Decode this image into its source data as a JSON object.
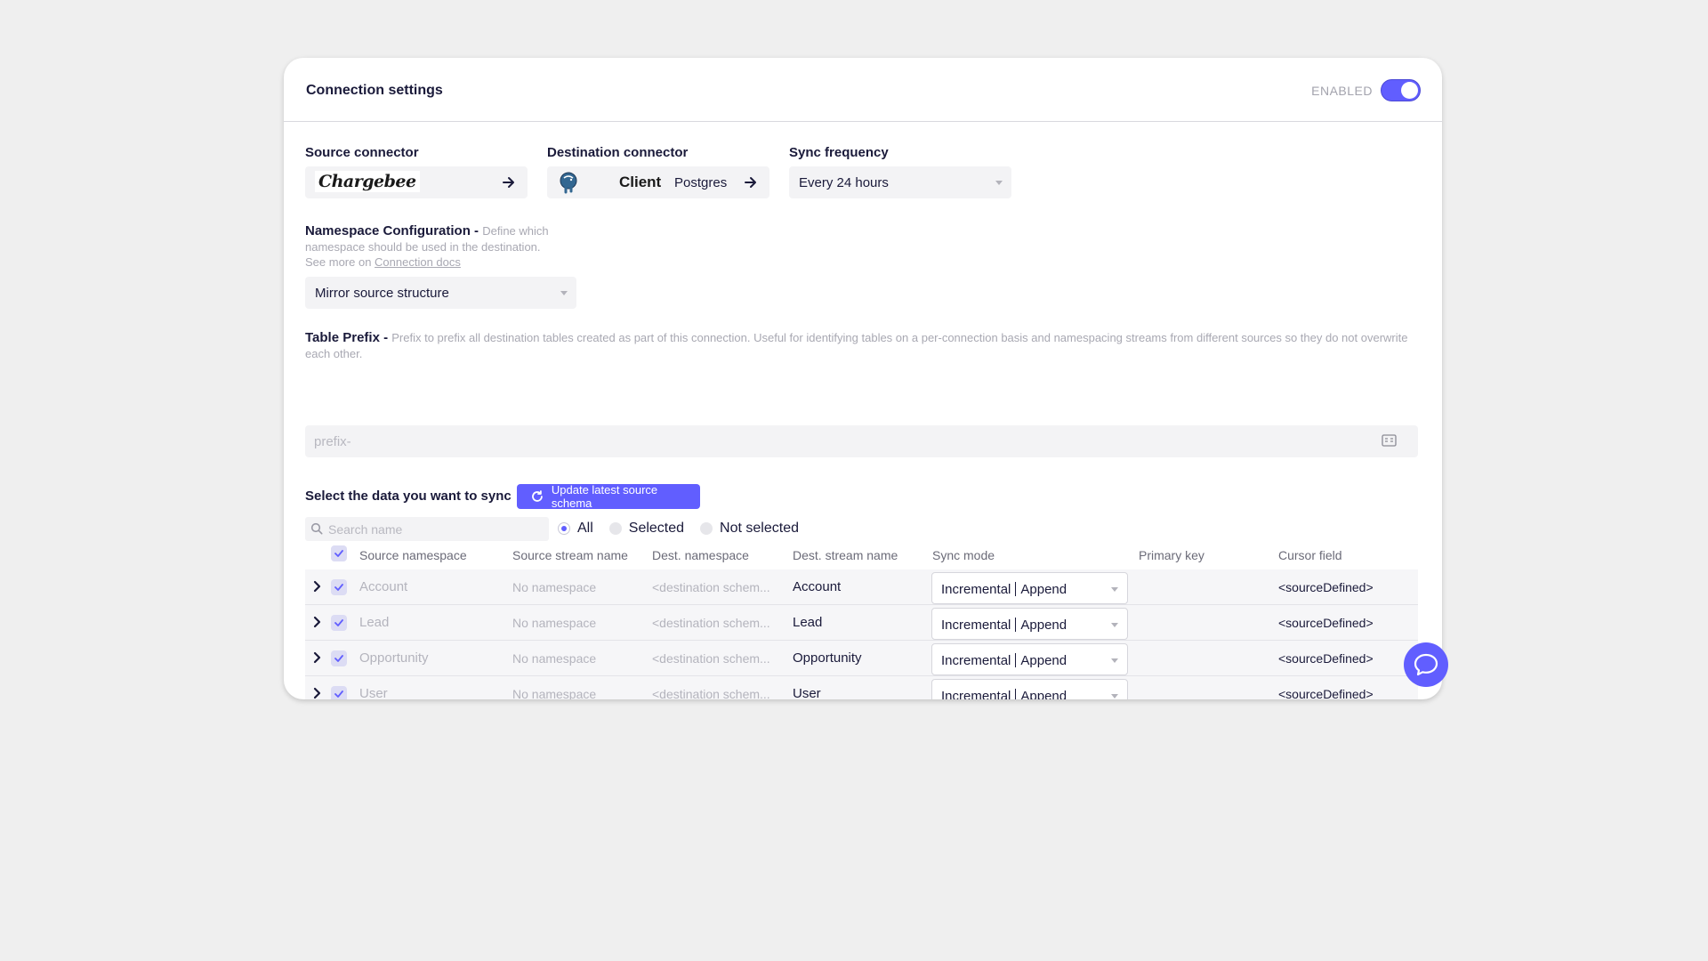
{
  "header": {
    "title": "Connection settings",
    "enabled_label": "ENABLED",
    "enabled": true
  },
  "source": {
    "label": "Source connector",
    "logo_text": "Chargebee"
  },
  "destination": {
    "label": "Destination connector",
    "name": "Client",
    "type": "Postgres"
  },
  "frequency": {
    "label": "Sync frequency",
    "value": "Every 24 hours"
  },
  "namespace": {
    "label": "Namespace Configuration - ",
    "desc_line1": "Define which",
    "desc_line2": "namespace should be used in the destination.",
    "desc_line3": "See more on ",
    "link": "Connection docs",
    "value": "Mirror source structure"
  },
  "prefix": {
    "label": "Table Prefix - ",
    "desc": "Prefix to prefix all destination tables created as part of this connection. Useful for identifying tables on a per-connection basis and namespacing streams from different sources so they do not overwrite each other.",
    "placeholder": "prefix-"
  },
  "sync": {
    "label": "Select the data you want to sync",
    "update_button": "Update latest source schema",
    "search_placeholder": "Search name",
    "filters": [
      "All",
      "Selected",
      "Not selected"
    ],
    "filter_selected": "All"
  },
  "table": {
    "headers": [
      "Source namespace",
      "Source stream name",
      "Dest. namespace",
      "Dest. stream name",
      "Sync mode",
      "Primary key",
      "Cursor field"
    ],
    "rows": [
      {
        "source_namespace": "Account",
        "source_stream": "No namespace",
        "dest_namespace": "<destination schem...",
        "dest_stream": "Account",
        "mode_a": "Incremental",
        "mode_b": "Append",
        "cursor": "<sourceDefined>"
      },
      {
        "source_namespace": "Lead",
        "source_stream": "No namespace",
        "dest_namespace": "<destination schem...",
        "dest_stream": "Lead",
        "mode_a": "Incremental",
        "mode_b": "Append",
        "cursor": "<sourceDefined>"
      },
      {
        "source_namespace": "Opportunity",
        "source_stream": "No namespace",
        "dest_namespace": "<destination schem...",
        "dest_stream": "Opportunity",
        "mode_a": "Incremental",
        "mode_b": "Append",
        "cursor": "<sourceDefined>"
      },
      {
        "source_namespace": "User",
        "source_stream": "No namespace",
        "dest_namespace": "<destination schem...",
        "dest_stream": "User",
        "mode_a": "Incremental",
        "mode_b": "Append",
        "cursor": "<sourceDefined>"
      }
    ]
  },
  "colors": {
    "accent": "#615eff",
    "background": "#efefef",
    "text": "#1a1a3a"
  },
  "icons": [
    "arrow-right-icon",
    "postgres-elephant-icon",
    "caret-down-icon",
    "keyboard-icon",
    "refresh-icon",
    "search-icon",
    "check-icon",
    "chevron-right-icon",
    "chat-icon"
  ]
}
